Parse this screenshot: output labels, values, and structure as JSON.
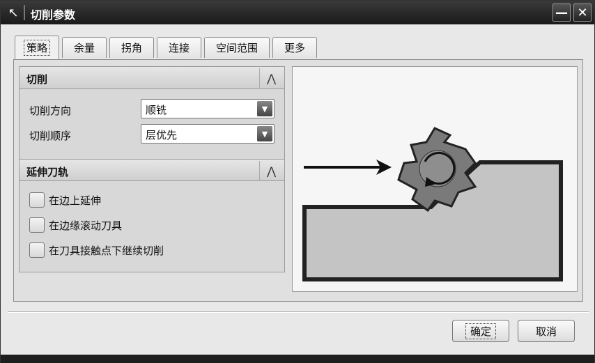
{
  "window": {
    "title": "切削参数",
    "icon": "cursor-pointer-icon",
    "minimize": "—",
    "close": "✕"
  },
  "tabs": [
    {
      "label": "策略",
      "active": true
    },
    {
      "label": "余量",
      "active": false
    },
    {
      "label": "拐角",
      "active": false
    },
    {
      "label": "连接",
      "active": false
    },
    {
      "label": "空间范围",
      "active": false
    },
    {
      "label": "更多",
      "active": false
    }
  ],
  "cut_group": {
    "title": "切削",
    "direction_label": "切削方向",
    "direction_value": "顺铣",
    "order_label": "切削顺序",
    "order_value": "层优先"
  },
  "extend_group": {
    "title": "延伸刀轨",
    "options": [
      {
        "label": "在边上延伸",
        "checked": false
      },
      {
        "label": "在边缘滚动刀具",
        "checked": false
      },
      {
        "label": "在刀具接触点下继续切削",
        "checked": false
      }
    ]
  },
  "buttons": {
    "ok": "确定",
    "cancel": "取消"
  }
}
